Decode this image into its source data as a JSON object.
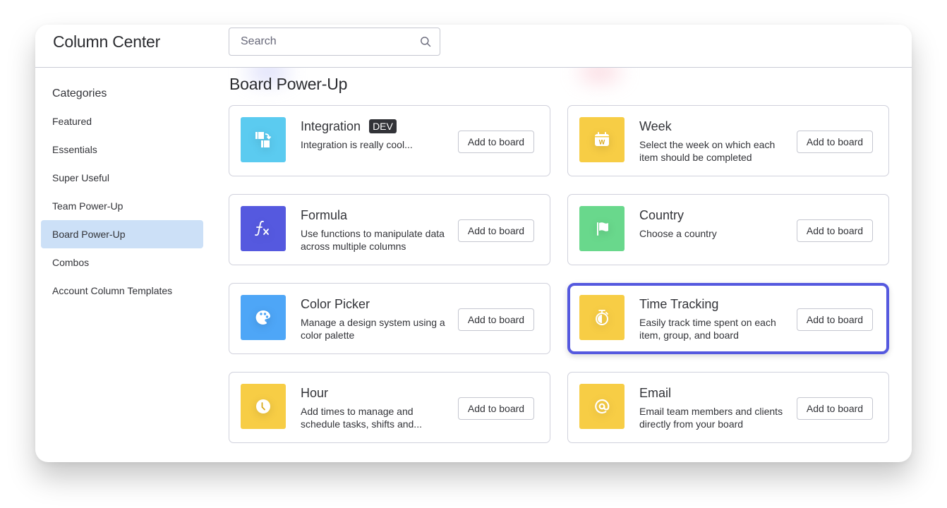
{
  "header": {
    "title": "Column Center",
    "search_placeholder": "Search",
    "search_value": ""
  },
  "sidebar": {
    "title": "Categories",
    "items": [
      {
        "label": "Featured",
        "active": false
      },
      {
        "label": "Essentials",
        "active": false
      },
      {
        "label": "Super Useful",
        "active": false
      },
      {
        "label": "Team Power-Up",
        "active": false
      },
      {
        "label": "Board Power-Up",
        "active": true
      },
      {
        "label": "Combos",
        "active": false
      },
      {
        "label": "Account Column Templates",
        "active": false
      }
    ]
  },
  "main": {
    "section_title": "Board Power-Up",
    "cards": [
      {
        "title": "Integration",
        "badge": "DEV",
        "description": "Integration is really cool...",
        "icon": "integration-icon",
        "color": "#5bcbf0",
        "button": "Add to board",
        "selected": false
      },
      {
        "title": "Week",
        "badge": null,
        "description": "Select the week on which each item should be completed",
        "icon": "calendar-week-icon",
        "color": "#f7cd45",
        "button": "Add to board",
        "selected": false
      },
      {
        "title": "Formula",
        "badge": null,
        "description": "Use functions to manipulate data across multiple columns",
        "icon": "formula-icon",
        "color": "#5559df",
        "button": "Add to board",
        "selected": false
      },
      {
        "title": "Country",
        "badge": null,
        "description": "Choose a country",
        "icon": "flag-icon",
        "color": "#69d88c",
        "button": "Add to board",
        "selected": false
      },
      {
        "title": "Color Picker",
        "badge": null,
        "description": "Manage a design system using a color palette",
        "icon": "palette-icon",
        "color": "#4ea6f7",
        "button": "Add to board",
        "selected": false
      },
      {
        "title": "Time Tracking",
        "badge": null,
        "description": "Easily track time spent on each item, group, and board",
        "icon": "stopwatch-icon",
        "color": "#f7cd45",
        "button": "Add to board",
        "selected": true
      },
      {
        "title": "Hour",
        "badge": null,
        "description": "Add times to manage and schedule tasks, shifts and...",
        "icon": "clock-icon",
        "color": "#f7cd45",
        "button": "Add to board",
        "selected": false
      },
      {
        "title": "Email",
        "badge": null,
        "description": "Email team members and clients directly from your board",
        "icon": "at-sign-icon",
        "color": "#f7cd45",
        "button": "Add to board",
        "selected": false
      }
    ]
  },
  "colors": {
    "selection": "#5559df",
    "active_category": "#cce0f7"
  }
}
